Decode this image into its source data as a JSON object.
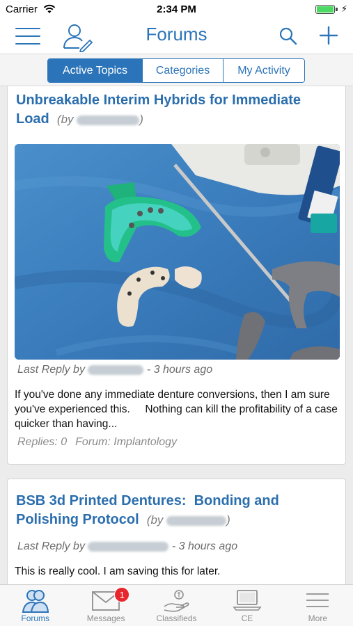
{
  "status_bar": {
    "carrier": "Carrier",
    "time": "2:34 PM",
    "battery_level": 1.0
  },
  "header": {
    "title": "Forums"
  },
  "segments": [
    {
      "label": "Active Topics",
      "active": true
    },
    {
      "label": "Categories",
      "active": false
    },
    {
      "label": "My Activity",
      "active": false
    }
  ],
  "posts": [
    {
      "title": "Unbreakable Interim Hybrids for Immediate Load",
      "by_label": "(by",
      "by_close": ")",
      "last_reply_label": "Last Reply by",
      "time_ago": "- 3 hours ago",
      "excerpt": "If you've done any immediate denture conversions, then I am sure you've experienced this.     Nothing can kill the profitability of a case quicker than having...",
      "replies": "Replies: 0",
      "forum": "Forum: Implantology"
    },
    {
      "title": "BSB 3d Printed Dentures:  Bonding and Polishing Protocol",
      "by_label": "(by",
      "by_close": ")",
      "last_reply_label": "Last Reply by",
      "time_ago": "- 3 hours ago",
      "excerpt": "This is really cool. I am saving this for later."
    }
  ],
  "tab_bar": {
    "tabs": [
      {
        "label": "Forums",
        "icon": "forums-icon",
        "active": true
      },
      {
        "label": "Messages",
        "icon": "envelope-icon",
        "badge": "1"
      },
      {
        "label": "Classifieds",
        "icon": "hand-money-icon"
      },
      {
        "label": "CE",
        "icon": "laptop-icon"
      },
      {
        "label": "More",
        "icon": "more-menu-icon"
      }
    ]
  },
  "colors": {
    "accent": "#2b74b9",
    "title_blue": "#2b6eae",
    "badge_red": "#e8262d",
    "battery_green": "#4cd964"
  }
}
